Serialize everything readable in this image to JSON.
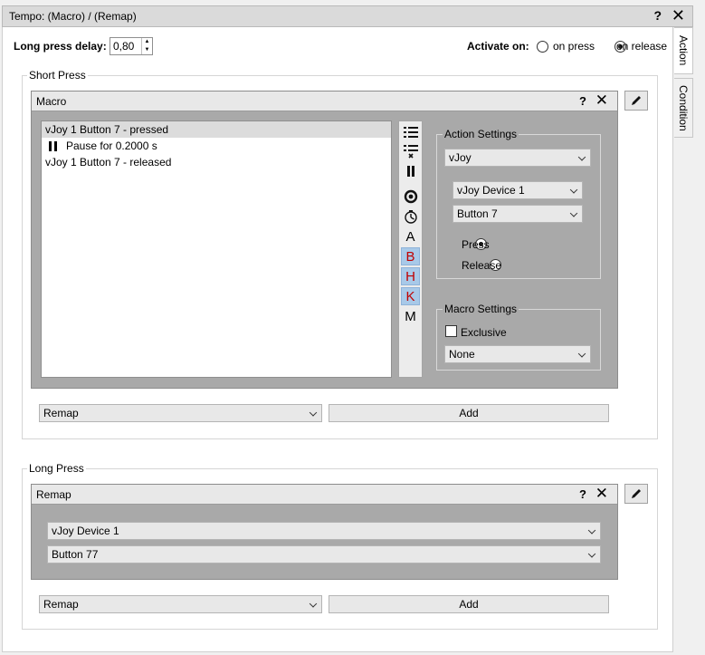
{
  "window": {
    "title": "Tempo: (Macro) / (Remap)",
    "help": "?",
    "close": "✕"
  },
  "tabs": [
    {
      "label": "Action",
      "active": true
    },
    {
      "label": "Condition",
      "active": false
    }
  ],
  "long_press_delay": {
    "label": "Long press delay:",
    "value": "0,80"
  },
  "activate_on": {
    "label": "Activate on:",
    "options": [
      {
        "label": "on press",
        "checked": false
      },
      {
        "label": "on release",
        "checked": true
      }
    ]
  },
  "short_press": {
    "group_title": "Short Press",
    "panel_title": "Macro",
    "help": "?",
    "close": "✕",
    "macro_items": [
      {
        "label": "vJoy 1 Button 7 - pressed",
        "selected": true,
        "icon": ""
      },
      {
        "label": "Pause for 0.2000 s",
        "selected": false,
        "icon": "pause-icon"
      },
      {
        "label": "vJoy 1 Button 7 - released",
        "selected": false,
        "icon": ""
      }
    ],
    "toolbar": [
      {
        "name": "list-add-icon",
        "glyph": "☰",
        "highlight": false
      },
      {
        "name": "list-remove-icon",
        "glyph": "☰",
        "highlight": false
      },
      {
        "name": "pause-icon",
        "glyph": "❚❚",
        "highlight": false
      },
      {
        "name": "record-icon",
        "glyph": "◉",
        "highlight": false
      },
      {
        "name": "timer-icon",
        "glyph": "◷",
        "highlight": false
      },
      {
        "name": "letter-a-icon",
        "glyph": "A",
        "highlight": false
      },
      {
        "name": "letter-b-icon",
        "glyph": "B",
        "highlight": true
      },
      {
        "name": "letter-h-icon",
        "glyph": "H",
        "highlight": true
      },
      {
        "name": "letter-k-icon",
        "glyph": "K",
        "highlight": true
      },
      {
        "name": "letter-m-icon",
        "glyph": "M",
        "highlight": false
      }
    ],
    "action_settings": {
      "title": "Action Settings",
      "type": "vJoy",
      "device": "vJoy Device 1",
      "button": "Button 7",
      "press_label": "Press",
      "release_label": "Release",
      "press_checked": true
    },
    "macro_settings": {
      "title": "Macro Settings",
      "exclusive_label": "Exclusive",
      "mode": "None"
    },
    "footer": {
      "combo": "Remap",
      "add": "Add"
    }
  },
  "long_press": {
    "group_title": "Long Press",
    "panel_title": "Remap",
    "help": "?",
    "close": "✕",
    "device": "vJoy Device 1",
    "button": "Button 77",
    "footer": {
      "combo": "Remap",
      "add": "Add"
    }
  },
  "colors": {
    "panel_bg": "#a9a9a9",
    "highlight_bg": "#a8c9e8",
    "highlight_text": "#c00000"
  }
}
